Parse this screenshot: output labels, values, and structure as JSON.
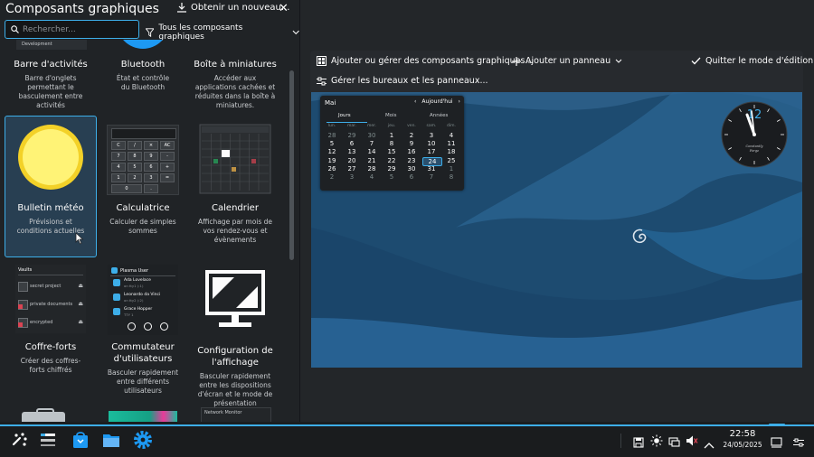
{
  "explorer": {
    "title": "Composants graphiques",
    "get_new": "Obtenir un nouveau...",
    "search_placeholder": "Rechercher...",
    "filter_label": "Tous les composants graphiques",
    "partial_top_label": "Development"
  },
  "widgets": [
    {
      "name": "Barre d'activités",
      "desc": "Barre d'onglets permettant le basculement entre activités"
    },
    {
      "name": "Bluetooth",
      "desc": "État et contrôle du Bluetooth"
    },
    {
      "name": "Boîte à miniatures",
      "desc": "Accéder aux applications cachées et réduites dans la boîte à miniatures."
    },
    {
      "name": "Bulletin météo",
      "desc": "Prévisions et conditions actuelles"
    },
    {
      "name": "Calculatrice",
      "desc": "Calculer de simples sommes"
    },
    {
      "name": "Calendrier",
      "desc": "Affichage par mois de vos rendez-vous et évènements"
    },
    {
      "name": "Coffre-forts",
      "desc": "Créer des coffres-forts chiffrés"
    },
    {
      "name": "Commutateur d'utilisateurs",
      "desc": "Basculer rapidement entre différents utilisateurs"
    },
    {
      "name": "Configuration de l'affichage",
      "desc": "Basculer rapidement entre les dispositions d'écran et le mode de présentation"
    }
  ],
  "vaults_preview": {
    "title": "Vaults",
    "items": [
      "secret project",
      "private documents",
      "encrypted"
    ]
  },
  "users_preview": {
    "header": "Plasma User",
    "users": [
      {
        "name": "Ada Lovelace",
        "sub": "on tty1 (:1)"
      },
      {
        "name": "Leonardo da Vinci",
        "sub": "on tty2 (:2)"
      },
      {
        "name": "Grace Hopper",
        "sub": "TTY 1"
      }
    ]
  },
  "network_preview_title": "Network Monitor",
  "toolbar": {
    "add_widgets": "Ajouter ou gérer des composants graphiques...",
    "add_panel": "Ajouter un panneau",
    "exit_edit": "Quitter le mode d'édition",
    "manage_desktops": "Gérer les bureaux et les panneaux..."
  },
  "calendar": {
    "month": "Mai",
    "today_label": "Aujourd'hui",
    "tabs": [
      "Jours",
      "Mois",
      "Années"
    ],
    "weekdays": [
      "lun.",
      "mar.",
      "mer.",
      "jeu.",
      "ven.",
      "sam.",
      "dim."
    ],
    "weeks": [
      [
        "28",
        "29",
        "30",
        "1",
        "2",
        "3",
        "4"
      ],
      [
        "5",
        "6",
        "7",
        "8",
        "9",
        "10",
        "11"
      ],
      [
        "12",
        "13",
        "14",
        "15",
        "16",
        "17",
        "18"
      ],
      [
        "19",
        "20",
        "21",
        "22",
        "23",
        "24",
        "25"
      ],
      [
        "26",
        "27",
        "28",
        "29",
        "30",
        "31",
        "1"
      ],
      [
        "2",
        "3",
        "4",
        "5",
        "6",
        "7",
        "8"
      ]
    ],
    "today": "24"
  },
  "clock": {
    "text_line1": "Constantly",
    "text_line2": "Forge"
  },
  "tray": {
    "time": "22:58",
    "date": "24/05/2025"
  },
  "calc_preview_keys": [
    "C",
    "/",
    "×",
    "AC",
    "7",
    "8",
    "9",
    "-",
    "4",
    "5",
    "6",
    "+",
    "1",
    "2",
    "3",
    "0",
    ".",
    "="
  ],
  "colors": {
    "accent": "#3daee9",
    "panel": "#202326",
    "desktop": "#232629"
  }
}
